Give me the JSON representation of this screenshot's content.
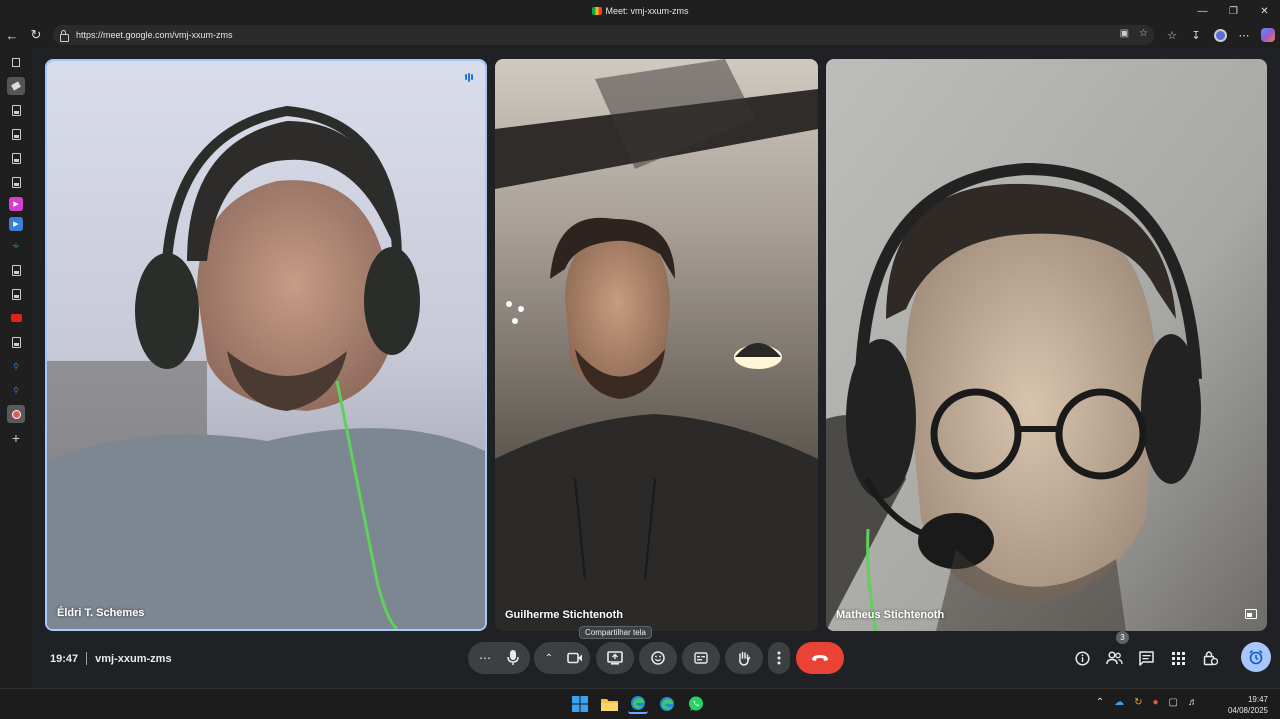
{
  "window": {
    "title": "Meet: vmj-xxum-zms"
  },
  "browser": {
    "url": "https://meet.google.com/vmj-xxum-zms"
  },
  "participants": [
    {
      "name": "Éldri T. Schemes",
      "speaking": true
    },
    {
      "name": "Guilherme Stichtenoth",
      "speaking": false
    },
    {
      "name": "Matheus Stichtenoth",
      "speaking": false
    }
  ],
  "meeting": {
    "time": "19:47",
    "code": "vmj-xxum-zms"
  },
  "controls": {
    "more_label": "⋯",
    "tooltip": "Compartilhar tela",
    "people_count": "3"
  },
  "taskbar": {
    "time": "19:47",
    "date": "04/08/2025"
  },
  "colors": {
    "leave": "#ea4335",
    "active_border": "#a8c7fa",
    "control_bg": "#3c4043"
  }
}
